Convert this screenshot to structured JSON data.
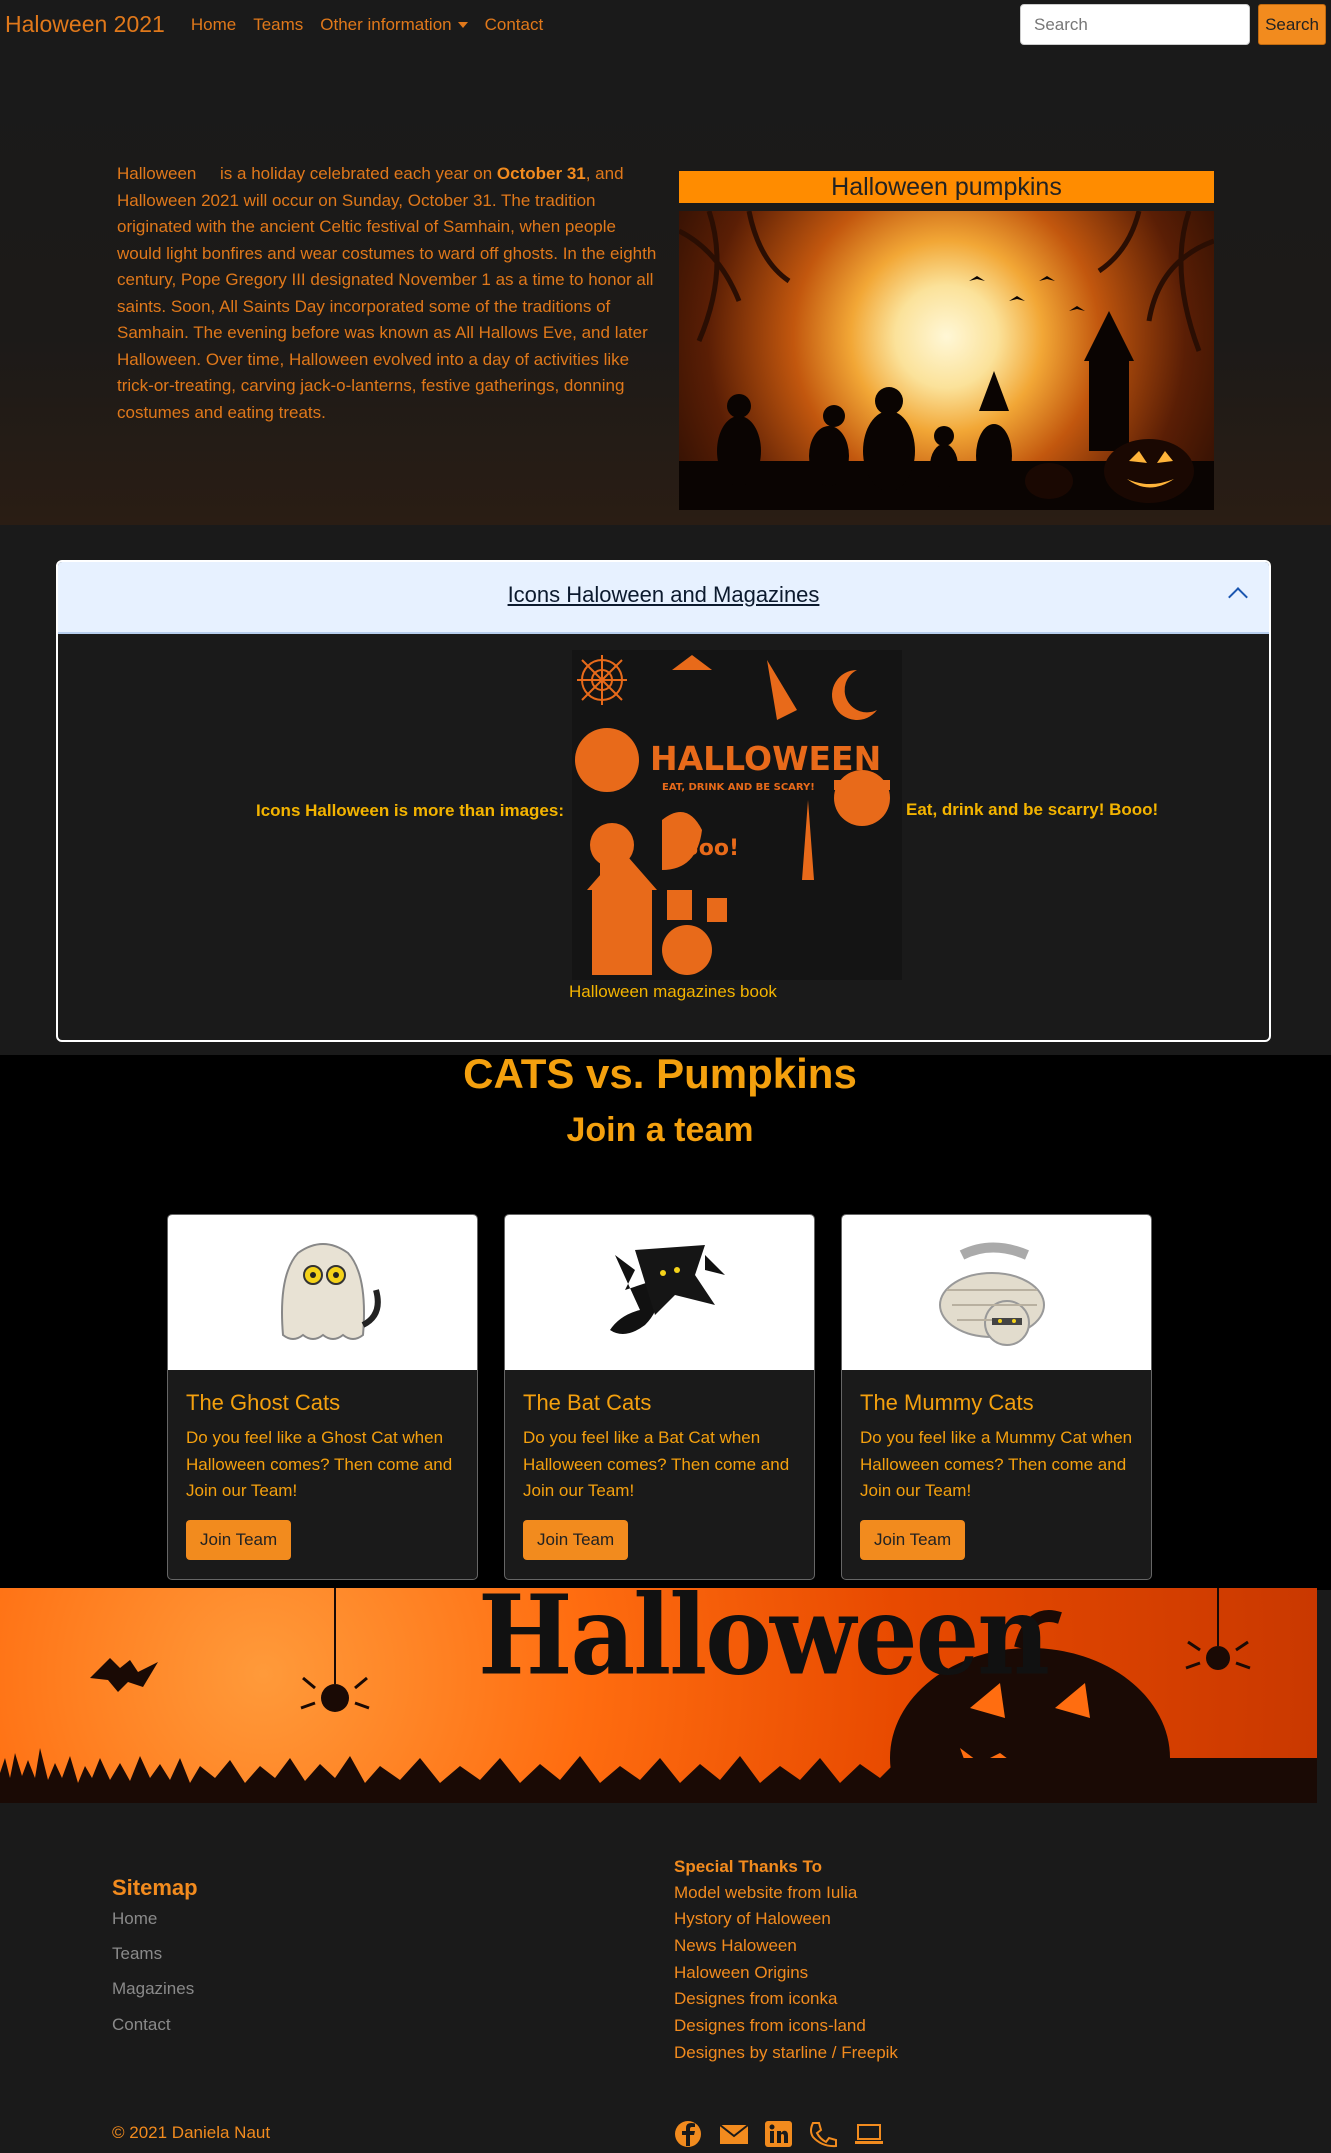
{
  "nav": {
    "brand": "Haloween 2021",
    "links": [
      "Home",
      "Teams",
      "Other information",
      "Contact"
    ],
    "search_placeholder": "Search",
    "search_button": "Search"
  },
  "hero": {
    "word": "Halloween",
    "intro": " is a holiday celebrated each year on ",
    "date_bold": "October 31",
    "body": ", and Halloween 2021 will occur on Sunday, October 31. The tradition originated with the ancient Celtic festival of Samhain, when people would light bonfires and wear costumes to ward off ghosts. In the eighth century, Pope Gregory III designated November 1 as a time to honor all saints. Soon, All Saints Day incorporated some of the traditions of Samhain. The evening before was known as All Hallows Eve, and later Halloween. Over time, Halloween evolved into a day of activities like trick-or-treating, carving jack-o-lanterns, festive gatherings, donning costumes and eating treats.",
    "image_title": "Halloween pumpkins"
  },
  "accordion": {
    "header": "Icons Haloween and Magazines",
    "left_text": "Icons Halloween is more than images:",
    "right_text": "Eat, drink and be scarry! Booo!",
    "caption": "Halloween magazines book",
    "magazine_title": "HALLOWEEN",
    "magazine_sub": "EAT, DRINK AND BE SCARY!",
    "magazine_boo": "Boo!"
  },
  "cats": {
    "title": "CATS vs. Pumpkins",
    "subtitle": "Join a team",
    "teams": [
      {
        "name": "The Ghost Cats",
        "text": "Do you feel like a Ghost Cat when Halloween comes? Then come and Join our Team!",
        "button": "Join Team"
      },
      {
        "name": "The Bat Cats",
        "text": "Do you feel like a Bat Cat when Halloween comes? Then come and Join our Team!",
        "button": "Join Team"
      },
      {
        "name": "The Mummy Cats",
        "text": "Do you feel like a Mummy Cat when Halloween comes? Then come and Join our Team!",
        "button": "Join Team"
      }
    ]
  },
  "banner": {
    "word": "Halloween"
  },
  "footer": {
    "sitemap_title": "Sitemap",
    "sitemap": [
      "Home",
      "Teams",
      "Magazines",
      "Contact"
    ],
    "thanks_title": "Special Thanks To",
    "thanks": [
      "Model website from Iulia",
      "Hystory of Haloween",
      "News Haloween",
      "Haloween Origins",
      "Designes from iconka",
      "Designes from icons-land",
      "Designes by starline / Freepik"
    ],
    "copyright": "© 2021 Daniela Naut",
    "social_icons": [
      "facebook-icon",
      "mail-icon",
      "linkedin-icon",
      "phone-icon",
      "laptop-icon"
    ]
  },
  "colors": {
    "accent": "#f28b1e",
    "gold": "#f4b400",
    "header_bg": "#e7f1ff"
  }
}
